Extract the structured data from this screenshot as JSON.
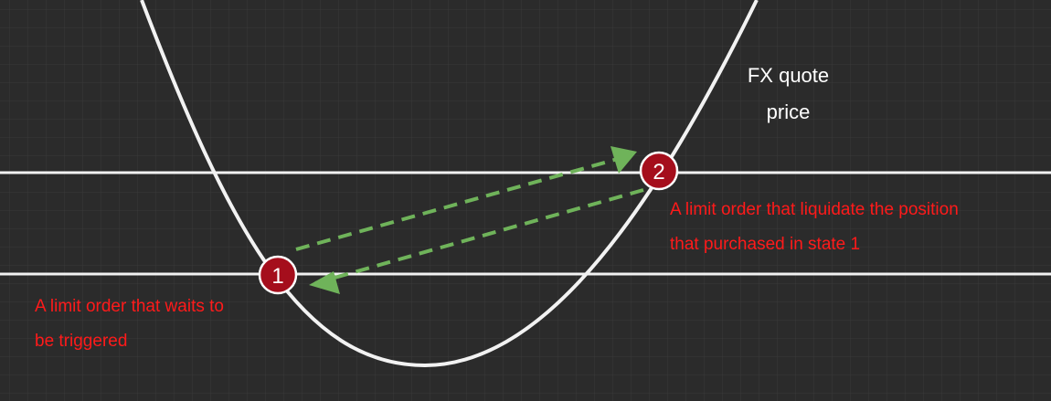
{
  "curve_label": [
    "FX quote",
    "price"
  ],
  "markers": [
    {
      "id": "1",
      "text": "1"
    },
    {
      "id": "2",
      "text": "2"
    }
  ],
  "annotations": {
    "state1": [
      "A limit order that waits to",
      "be triggered"
    ],
    "state2": [
      "A limit order that liquidate the position",
      "that purchased in state 1"
    ]
  },
  "colors": {
    "background": "#2b2b2b",
    "grid": "#3c3c3c",
    "line": "#f2f2f2",
    "arrow": "#6fb35a",
    "marker_fill": "#a50e1c",
    "text_red": "#ff1a1a"
  }
}
